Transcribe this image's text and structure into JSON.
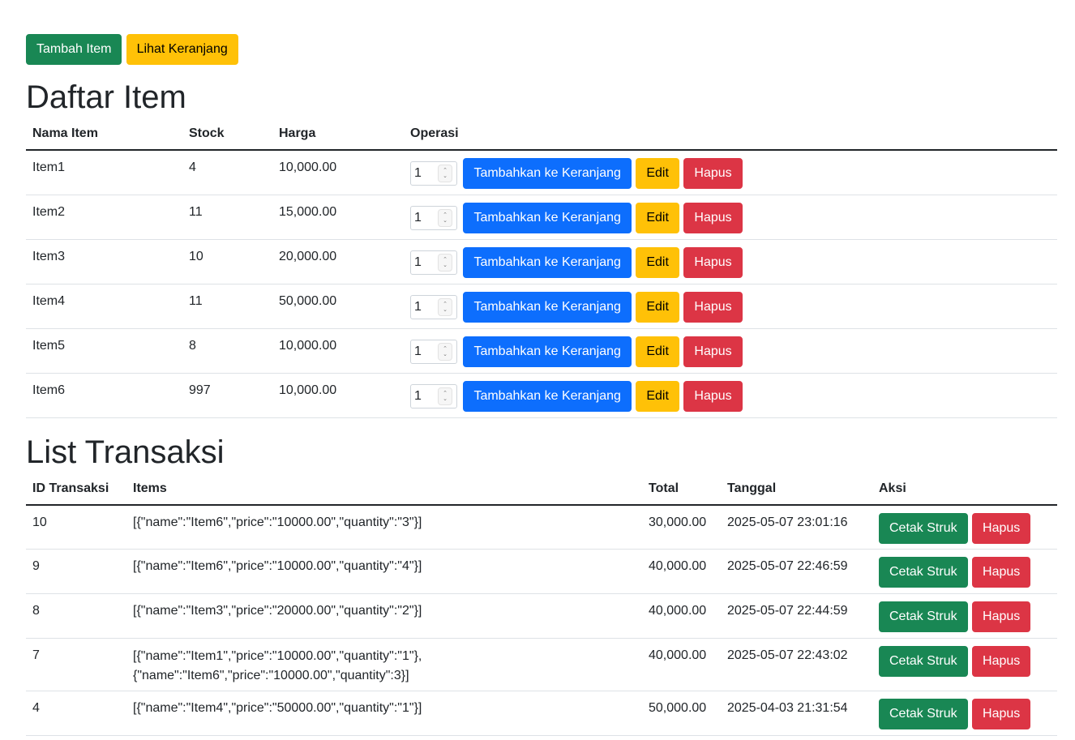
{
  "top_actions": {
    "add_item_label": "Tambah Item",
    "view_cart_label": "Lihat Keranjang"
  },
  "items_section": {
    "title": "Daftar Item",
    "columns": [
      "Nama Item",
      "Stock",
      "Harga",
      "Operasi"
    ],
    "add_to_cart_label": "Tambahkan ke Keranjang",
    "edit_label": "Edit",
    "delete_label": "Hapus",
    "rows": [
      {
        "name": "Item1",
        "stock": "4",
        "price": "10,000.00",
        "qty": "1"
      },
      {
        "name": "Item2",
        "stock": "11",
        "price": "15,000.00",
        "qty": "1"
      },
      {
        "name": "Item3",
        "stock": "10",
        "price": "20,000.00",
        "qty": "1"
      },
      {
        "name": "Item4",
        "stock": "11",
        "price": "50,000.00",
        "qty": "1"
      },
      {
        "name": "Item5",
        "stock": "8",
        "price": "10,000.00",
        "qty": "1"
      },
      {
        "name": "Item6",
        "stock": "997",
        "price": "10,000.00",
        "qty": "1"
      }
    ]
  },
  "transactions_section": {
    "title": "List Transaksi",
    "columns": [
      "ID Transaksi",
      "Items",
      "Total",
      "Tanggal",
      "Aksi"
    ],
    "print_label": "Cetak Struk",
    "delete_label": "Hapus",
    "rows": [
      {
        "id": "10",
        "items": "[{\"name\":\"Item6\",\"price\":\"10000.00\",\"quantity\":\"3\"}]",
        "total": "30,000.00",
        "date": "2025-05-07 23:01:16"
      },
      {
        "id": "9",
        "items": "[{\"name\":\"Item6\",\"price\":\"10000.00\",\"quantity\":\"4\"}]",
        "total": "40,000.00",
        "date": "2025-05-07 22:46:59"
      },
      {
        "id": "8",
        "items": "[{\"name\":\"Item3\",\"price\":\"20000.00\",\"quantity\":\"2\"}]",
        "total": "40,000.00",
        "date": "2025-05-07 22:44:59"
      },
      {
        "id": "7",
        "items": "[{\"name\":\"Item1\",\"price\":\"10000.00\",\"quantity\":\"1\"},\n{\"name\":\"Item6\",\"price\":\"10000.00\",\"quantity\":3}]",
        "total": "40,000.00",
        "date": "2025-05-07 22:43:02"
      },
      {
        "id": "4",
        "items": "[{\"name\":\"Item4\",\"price\":\"50000.00\",\"quantity\":\"1\"}]",
        "total": "50,000.00",
        "date": "2025-04-03 21:31:54"
      }
    ]
  },
  "colors": {
    "success": "#198754",
    "warning": "#ffc107",
    "primary": "#0d6efd",
    "danger": "#dc3545"
  }
}
